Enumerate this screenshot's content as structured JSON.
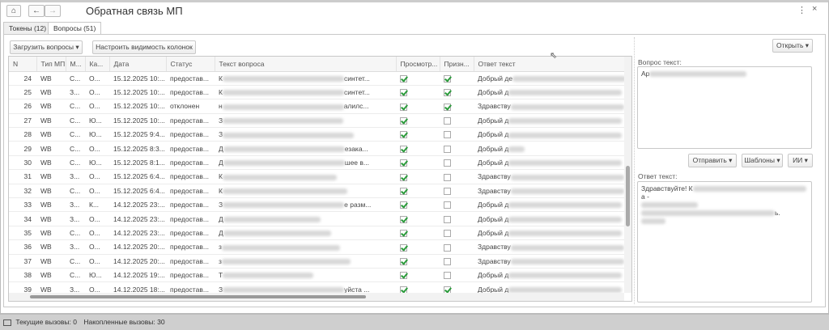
{
  "window": {
    "title": "Обратная связь МП",
    "menu_icon": "more-vertical-icon",
    "close_icon": "close-icon"
  },
  "nav": {
    "home": "⌂",
    "back": "←",
    "forward": "→"
  },
  "tabs": [
    {
      "label": "Токены (12)"
    },
    {
      "label": "Вопросы (51)"
    }
  ],
  "toolbar": {
    "load_label": "Загрузить вопросы",
    "columns_label": "Настроить видимость колонок",
    "open_label": "Открыть"
  },
  "columns": [
    "N",
    "Тип МП",
    "М...",
    "Ка...",
    "Дата",
    "Статус",
    "Текст вопроса",
    "Просмотр...",
    "Призн...",
    "Ответ текст"
  ],
  "rows": [
    {
      "n": "24",
      "mp": "WB",
      "m": "С...",
      "k": "О...",
      "date": "15.12.2025 10:...",
      "status": "предостав...",
      "q": "К",
      "q_end": "синтет...",
      "viewed": true,
      "rec": true,
      "a": "Добрый де"
    },
    {
      "n": "25",
      "mp": "WB",
      "m": "З...",
      "k": "О...",
      "date": "15.12.2025 10:...",
      "status": "предостав...",
      "q": "К",
      "q_end": "синтет...",
      "viewed": true,
      "rec": true,
      "a": "Добрый д"
    },
    {
      "n": "26",
      "mp": "WB",
      "m": "С...",
      "k": "О...",
      "date": "15.12.2025 10:...",
      "status": "отклонен",
      "q": "н",
      "q_end": "алилс...",
      "viewed": true,
      "rec": true,
      "a": "Здравству"
    },
    {
      "n": "27",
      "mp": "WB",
      "m": "С...",
      "k": "Ю...",
      "date": "15.12.2025 10:...",
      "status": "предостав...",
      "q": "З",
      "q_end": "",
      "viewed": true,
      "rec": false,
      "a": "Добрый д"
    },
    {
      "n": "28",
      "mp": "WB",
      "m": "С...",
      "k": "Ю...",
      "date": "15.12.2025 9:4...",
      "status": "предостав...",
      "q": "З",
      "q_end": "",
      "viewed": true,
      "rec": false,
      "a": "Добрый д"
    },
    {
      "n": "29",
      "mp": "WB",
      "m": "С...",
      "k": "О...",
      "date": "15.12.2025 8:3...",
      "status": "предостав...",
      "q": "Д",
      "q_end": "езака...",
      "viewed": true,
      "rec": false,
      "a": "Добрый д"
    },
    {
      "n": "30",
      "mp": "WB",
      "m": "С...",
      "k": "Ю...",
      "date": "15.12.2025 8:1...",
      "status": "предостав...",
      "q": "Д",
      "q_end": "шее в...",
      "viewed": true,
      "rec": false,
      "a": "Добрый д"
    },
    {
      "n": "31",
      "mp": "WB",
      "m": "З...",
      "k": "О...",
      "date": "15.12.2025 6:4...",
      "status": "предостав...",
      "q": "К",
      "q_end": "",
      "viewed": true,
      "rec": false,
      "a": "Здравству"
    },
    {
      "n": "32",
      "mp": "WB",
      "m": "С...",
      "k": "О...",
      "date": "15.12.2025 6:4...",
      "status": "предостав...",
      "q": "К",
      "q_end": "",
      "viewed": true,
      "rec": false,
      "a": "Здравству"
    },
    {
      "n": "33",
      "mp": "WB",
      "m": "З...",
      "k": "К...",
      "date": "14.12.2025 23:...",
      "status": "предостав...",
      "q": "З",
      "q_end": "е разм...",
      "viewed": true,
      "rec": false,
      "a": "Добрый д"
    },
    {
      "n": "34",
      "mp": "WB",
      "m": "З...",
      "k": "О...",
      "date": "14.12.2025 23:...",
      "status": "предостав...",
      "q": "Д",
      "q_end": "",
      "viewed": true,
      "rec": false,
      "a": "Добрый д"
    },
    {
      "n": "35",
      "mp": "WB",
      "m": "С...",
      "k": "О...",
      "date": "14.12.2025 23:...",
      "status": "предостав...",
      "q": "Д",
      "q_end": "",
      "viewed": true,
      "rec": false,
      "a": "Добрый д"
    },
    {
      "n": "36",
      "mp": "WB",
      "m": "З...",
      "k": "О...",
      "date": "14.12.2025 20:...",
      "status": "предостав...",
      "q": "з",
      "q_end": "",
      "viewed": true,
      "rec": false,
      "a": "Здравству"
    },
    {
      "n": "37",
      "mp": "WB",
      "m": "С...",
      "k": "О...",
      "date": "14.12.2025 20:...",
      "status": "предостав...",
      "q": "з",
      "q_end": "",
      "viewed": true,
      "rec": false,
      "a": "Здравству"
    },
    {
      "n": "38",
      "mp": "WB",
      "m": "С...",
      "k": "Ю...",
      "date": "14.12.2025 19:...",
      "status": "предостав...",
      "q": "Т",
      "q_end": "",
      "viewed": true,
      "rec": false,
      "a": "Добрый д"
    },
    {
      "n": "39",
      "mp": "WB",
      "m": "З...",
      "k": "О...",
      "date": "14.12.2025 18:...",
      "status": "предостав...",
      "q": "З",
      "q_end": "уйста ...",
      "viewed": true,
      "rec": true,
      "a": "Добрый д"
    }
  ],
  "right": {
    "question_label": "Вопрос текст:",
    "question_text": "Ар",
    "send_label": "Отправить",
    "templates_label": "Шаблоны",
    "ai_label": "ИИ",
    "answer_label": "Ответ текст:",
    "answer_line1": "Здравствуйте! К",
    "answer_line1_end": "а -",
    "answer_line3_end": "ь."
  },
  "status": {
    "current": "Текущие вызовы: 0",
    "accumulated": "Накопленные вызовы: 30"
  }
}
